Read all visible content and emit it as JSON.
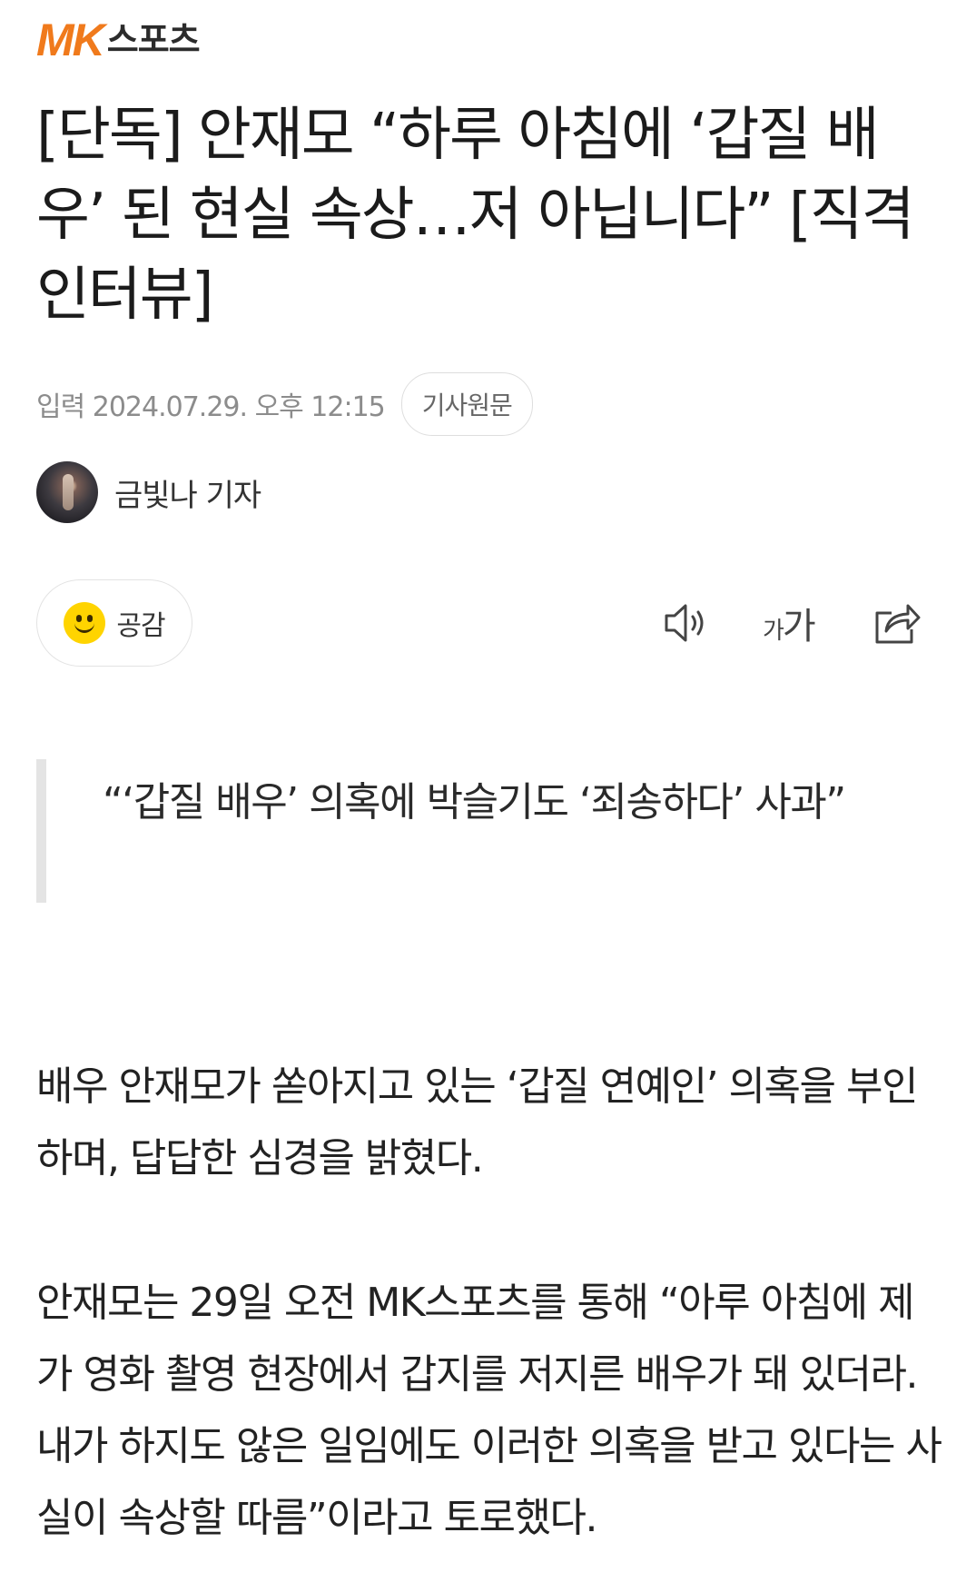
{
  "logo": {
    "mk": "MK",
    "sports": "스포츠"
  },
  "article": {
    "headline": "[단독] 안재모 “하루 아침에 ‘갑질 배우’ 된 현실 속상…저 아닙니다” [직격인터뷰]",
    "published": "입력 2024.07.29. 오후 12:15",
    "source_button": "기사원문",
    "author": "금빛나 기자",
    "quote": "“‘갑질 배우’ 의혹에 박슬기도 ‘죄송하다’ 사과”",
    "paragraphs": [
      "배우 안재모가 쏟아지고 있는 ‘갑질 연예인’ 의혹을 부인하며, 답답한 심경을 밝혔다.",
      "안재모는 29일 오전 MK스포츠를 통해 “아루 아침에 제가 영화 촬영 현장에서 갑지를 저지른 배우가 돼 있더라. 내가 하지도 않은 일임에도 이러한 의혹을 받고 있다는 사실이 속상할 따름”이라고 토로했다."
    ]
  },
  "actions": {
    "like_label": "공감",
    "font_size_small": "가",
    "font_size_large": "가",
    "icons": [
      "smile-icon",
      "speaker-icon",
      "font-size-icon",
      "share-icon"
    ]
  },
  "colors": {
    "brand_orange": "#f07a1c",
    "text_primary": "#222222",
    "text_meta": "#8c8c8c",
    "quote_bar": "#e4e4e4",
    "smile_yellow": "#ffd400"
  }
}
